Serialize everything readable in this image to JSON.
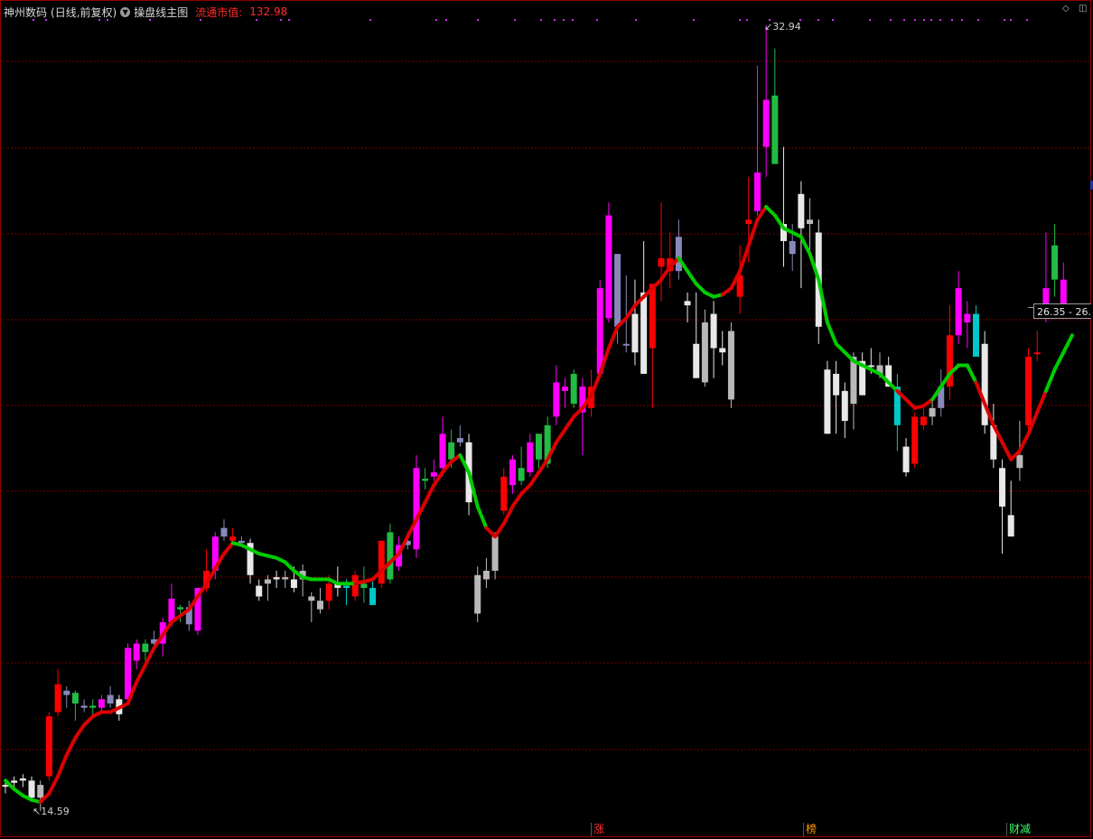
{
  "header": {
    "stock_name": "神州数码",
    "period_info": "(日线,前复权)",
    "indicator_name": "操盘线主图",
    "market_cap_label": "流通市值:",
    "market_cap_value": "132.98"
  },
  "labels": {
    "high_marker": "32.94",
    "low_marker": "14.59",
    "current_price": "26.35 - 26."
  },
  "bottom_tags": {
    "zhang": "涨",
    "bang": "榜",
    "caijian": "财减"
  },
  "colors": {
    "background": "#000000",
    "grid": "#7a0000",
    "up_candle": "#ff0000",
    "hot_candle": "#ff00ff",
    "down_candle": "#e8e8e8",
    "gray_candle": "#b8b8b8",
    "lavender_candle": "#8888bb",
    "green_candle": "#22bb44",
    "cyan_candle": "#00c8c8",
    "line_up": "#dd0000",
    "line_down": "#00cc00",
    "signal_dots": "#cc33ff"
  },
  "chart_data": {
    "type": "candlestick",
    "title": "",
    "price_high": 32.94,
    "price_low": 14.59,
    "current_price": 26.35,
    "candles": [
      {
        "o": 15.2,
        "h": 15.3,
        "l": 15.0,
        "c": 15.2,
        "col": "down"
      },
      {
        "o": 15.25,
        "h": 15.4,
        "l": 15.1,
        "c": 15.3,
        "col": "down"
      },
      {
        "o": 15.3,
        "h": 15.45,
        "l": 15.15,
        "c": 15.35,
        "col": "down"
      },
      {
        "o": 15.3,
        "h": 15.4,
        "l": 14.8,
        "c": 14.9,
        "col": "down"
      },
      {
        "o": 14.9,
        "h": 15.3,
        "l": 14.59,
        "c": 15.2,
        "col": "gray"
      },
      {
        "o": 15.4,
        "h": 16.9,
        "l": 15.3,
        "c": 16.8,
        "col": "up"
      },
      {
        "o": 16.9,
        "h": 17.9,
        "l": 16.8,
        "c": 17.55,
        "col": "up"
      },
      {
        "o": 17.3,
        "h": 17.5,
        "l": 17.0,
        "c": 17.4,
        "col": "lav"
      },
      {
        "o": 17.1,
        "h": 17.4,
        "l": 16.7,
        "c": 17.35,
        "col": "green"
      },
      {
        "o": 17.0,
        "h": 17.2,
        "l": 16.9,
        "c": 17.05,
        "col": "lav"
      },
      {
        "o": 17.0,
        "h": 17.2,
        "l": 16.8,
        "c": 17.05,
        "col": "green"
      },
      {
        "o": 17.0,
        "h": 17.3,
        "l": 16.9,
        "c": 17.2,
        "col": "hot"
      },
      {
        "o": 17.1,
        "h": 17.5,
        "l": 17.0,
        "c": 17.3,
        "col": "lav"
      },
      {
        "o": 17.2,
        "h": 17.3,
        "l": 16.7,
        "c": 16.85,
        "col": "down"
      },
      {
        "o": 17.2,
        "h": 18.5,
        "l": 17.1,
        "c": 18.4,
        "col": "hot"
      },
      {
        "o": 18.1,
        "h": 18.6,
        "l": 17.9,
        "c": 18.5,
        "col": "hot"
      },
      {
        "o": 18.3,
        "h": 18.6,
        "l": 18.1,
        "c": 18.5,
        "col": "green"
      },
      {
        "o": 18.5,
        "h": 18.8,
        "l": 18.3,
        "c": 18.6,
        "col": "lav"
      },
      {
        "o": 18.5,
        "h": 19.1,
        "l": 18.2,
        "c": 19.0,
        "col": "hot"
      },
      {
        "o": 19.0,
        "h": 19.9,
        "l": 18.9,
        "c": 19.55,
        "col": "hot"
      },
      {
        "o": 19.3,
        "h": 19.4,
        "l": 19.0,
        "c": 19.35,
        "col": "green"
      },
      {
        "o": 18.95,
        "h": 19.5,
        "l": 18.8,
        "c": 19.35,
        "col": "lav"
      },
      {
        "o": 18.8,
        "h": 19.5,
        "l": 18.7,
        "c": 19.8,
        "col": "hot"
      },
      {
        "o": 19.8,
        "h": 20.7,
        "l": 19.7,
        "c": 20.2,
        "col": "up"
      },
      {
        "o": 20.2,
        "h": 21.1,
        "l": 20.0,
        "c": 21.0,
        "col": "hot"
      },
      {
        "o": 21.0,
        "h": 21.4,
        "l": 20.9,
        "c": 21.2,
        "col": "lav"
      },
      {
        "o": 21.0,
        "h": 21.2,
        "l": 20.8,
        "c": 20.9,
        "col": "up"
      },
      {
        "o": 20.9,
        "h": 21.0,
        "l": 20.85,
        "c": 20.85,
        "col": "lav"
      },
      {
        "o": 20.85,
        "h": 20.95,
        "l": 19.9,
        "c": 20.1,
        "col": "down"
      },
      {
        "o": 19.85,
        "h": 20.0,
        "l": 19.5,
        "c": 19.6,
        "col": "down"
      },
      {
        "o": 19.9,
        "h": 20.1,
        "l": 19.5,
        "c": 20.0,
        "col": "gray"
      },
      {
        "o": 20.05,
        "h": 20.2,
        "l": 19.8,
        "c": 20.0,
        "col": "down"
      },
      {
        "o": 20.05,
        "h": 20.2,
        "l": 19.8,
        "c": 20.0,
        "col": "gray"
      },
      {
        "o": 20.0,
        "h": 20.3,
        "l": 19.7,
        "c": 19.8,
        "col": "down"
      },
      {
        "o": 20.2,
        "h": 20.35,
        "l": 19.6,
        "c": 20.0,
        "col": "gray"
      },
      {
        "o": 19.5,
        "h": 19.7,
        "l": 19.0,
        "c": 19.6,
        "col": "gray"
      },
      {
        "o": 19.3,
        "h": 19.8,
        "l": 19.2,
        "c": 19.5,
        "col": "gray"
      },
      {
        "o": 19.5,
        "h": 20.1,
        "l": 19.3,
        "c": 19.9,
        "col": "up"
      },
      {
        "o": 19.8,
        "h": 20.3,
        "l": 19.6,
        "c": 19.9,
        "col": "down"
      },
      {
        "o": 19.8,
        "h": 20.0,
        "l": 19.4,
        "c": 19.85,
        "col": "cyan"
      },
      {
        "o": 19.6,
        "h": 20.2,
        "l": 19.5,
        "c": 20.1,
        "col": "up"
      },
      {
        "o": 19.8,
        "h": 20.3,
        "l": 19.45,
        "c": 19.9,
        "col": "green"
      },
      {
        "o": 19.8,
        "h": 20.0,
        "l": 19.4,
        "c": 19.4,
        "col": "cyan"
      },
      {
        "o": 19.9,
        "h": 20.9,
        "l": 19.8,
        "c": 20.9,
        "col": "up"
      },
      {
        "o": 20.0,
        "h": 21.3,
        "l": 19.9,
        "c": 21.1,
        "col": "green"
      },
      {
        "o": 20.3,
        "h": 21.0,
        "l": 20.2,
        "c": 20.8,
        "col": "hot"
      },
      {
        "o": 20.8,
        "h": 21.1,
        "l": 20.7,
        "c": 20.9,
        "col": "lav"
      },
      {
        "o": 20.7,
        "h": 22.9,
        "l": 20.5,
        "c": 22.6,
        "col": "hot"
      },
      {
        "o": 22.3,
        "h": 22.6,
        "l": 22.1,
        "c": 22.35,
        "col": "green"
      },
      {
        "o": 22.4,
        "h": 22.8,
        "l": 22.3,
        "c": 22.5,
        "col": "hot"
      },
      {
        "o": 22.6,
        "h": 23.8,
        "l": 22.4,
        "c": 23.4,
        "col": "hot"
      },
      {
        "o": 22.8,
        "h": 23.5,
        "l": 22.6,
        "c": 23.2,
        "col": "green"
      },
      {
        "o": 23.3,
        "h": 23.6,
        "l": 23.1,
        "c": 23.2,
        "col": "lav"
      },
      {
        "o": 23.2,
        "h": 23.4,
        "l": 21.5,
        "c": 21.8,
        "col": "down"
      },
      {
        "o": 20.1,
        "h": 20.3,
        "l": 19.0,
        "c": 19.2,
        "col": "gray"
      },
      {
        "o": 20.0,
        "h": 20.5,
        "l": 19.8,
        "c": 20.2,
        "col": "gray"
      },
      {
        "o": 20.2,
        "h": 21.1,
        "l": 20.0,
        "c": 21.0,
        "col": "gray"
      },
      {
        "o": 21.6,
        "h": 22.6,
        "l": 21.5,
        "c": 22.4,
        "col": "up"
      },
      {
        "o": 22.2,
        "h": 22.9,
        "l": 22.0,
        "c": 22.8,
        "col": "hot"
      },
      {
        "o": 22.3,
        "h": 23.1,
        "l": 22.2,
        "c": 22.6,
        "col": "green"
      },
      {
        "o": 22.5,
        "h": 23.4,
        "l": 22.4,
        "c": 23.2,
        "col": "hot"
      },
      {
        "o": 22.8,
        "h": 23.4,
        "l": 22.6,
        "c": 23.4,
        "col": "green"
      },
      {
        "o": 22.7,
        "h": 23.8,
        "l": 22.6,
        "c": 23.6,
        "col": "green"
      },
      {
        "o": 23.8,
        "h": 25.0,
        "l": 23.6,
        "c": 24.6,
        "col": "hot"
      },
      {
        "o": 24.4,
        "h": 24.7,
        "l": 24.0,
        "c": 24.5,
        "col": "hot"
      },
      {
        "o": 24.1,
        "h": 24.9,
        "l": 24.0,
        "c": 24.8,
        "col": "green"
      },
      {
        "o": 24.5,
        "h": 24.7,
        "l": 22.9,
        "c": 23.9,
        "col": "hot"
      },
      {
        "o": 24.0,
        "h": 24.9,
        "l": 23.8,
        "c": 24.5,
        "col": "up"
      },
      {
        "o": 24.8,
        "h": 27.0,
        "l": 24.7,
        "c": 26.8,
        "col": "hot"
      },
      {
        "o": 26.1,
        "h": 28.8,
        "l": 26.0,
        "c": 28.5,
        "col": "hot"
      },
      {
        "o": 25.9,
        "h": 26.6,
        "l": 25.5,
        "c": 27.6,
        "col": "lav"
      },
      {
        "o": 25.5,
        "h": 27.1,
        "l": 25.3,
        "c": 25.5,
        "col": "lav"
      },
      {
        "o": 26.2,
        "h": 27.0,
        "l": 25.0,
        "c": 25.3,
        "col": "down"
      },
      {
        "o": 26.7,
        "h": 27.9,
        "l": 25.3,
        "c": 24.8,
        "col": "down"
      },
      {
        "o": 25.4,
        "h": 26.9,
        "l": 24.0,
        "c": 26.9,
        "col": "up"
      },
      {
        "o": 27.5,
        "h": 28.8,
        "l": 26.5,
        "c": 27.3,
        "col": "up"
      },
      {
        "o": 27.2,
        "h": 28.1,
        "l": 26.8,
        "c": 27.5,
        "col": "up"
      },
      {
        "o": 27.2,
        "h": 28.4,
        "l": 27.0,
        "c": 28.0,
        "col": "lav"
      },
      {
        "o": 26.5,
        "h": 26.7,
        "l": 26.0,
        "c": 26.4,
        "col": "down"
      },
      {
        "o": 25.5,
        "h": 26.7,
        "l": 24.7,
        "c": 24.7,
        "col": "down"
      },
      {
        "o": 26.0,
        "h": 26.3,
        "l": 24.5,
        "c": 24.6,
        "col": "gray"
      },
      {
        "o": 26.2,
        "h": 26.5,
        "l": 24.7,
        "c": 25.4,
        "col": "down"
      },
      {
        "o": 25.4,
        "h": 25.8,
        "l": 25.0,
        "c": 25.3,
        "col": "down"
      },
      {
        "o": 25.8,
        "h": 26.0,
        "l": 24.0,
        "c": 24.2,
        "col": "gray"
      },
      {
        "o": 26.6,
        "h": 27.8,
        "l": 26.2,
        "c": 27.1,
        "col": "up"
      },
      {
        "o": 28.3,
        "h": 29.4,
        "l": 27.4,
        "c": 28.4,
        "col": "up"
      },
      {
        "o": 28.6,
        "h": 32.0,
        "l": 28.5,
        "c": 29.5,
        "col": "hot"
      },
      {
        "o": 30.1,
        "h": 32.94,
        "l": 29.4,
        "c": 31.2,
        "col": "hot"
      },
      {
        "o": 31.3,
        "h": 32.4,
        "l": 30.0,
        "c": 29.7,
        "col": "green"
      },
      {
        "o": 27.9,
        "h": 30.1,
        "l": 27.3,
        "c": 28.3,
        "col": "down"
      },
      {
        "o": 27.9,
        "h": 28.3,
        "l": 27.2,
        "c": 27.6,
        "col": "lav"
      },
      {
        "o": 29.0,
        "h": 29.3,
        "l": 26.8,
        "c": 28.2,
        "col": "down"
      },
      {
        "o": 28.4,
        "h": 28.9,
        "l": 27.6,
        "c": 28.3,
        "col": "gray"
      },
      {
        "o": 28.1,
        "h": 28.4,
        "l": 25.5,
        "c": 25.9,
        "col": "down"
      },
      {
        "o": 24.9,
        "h": 25.1,
        "l": 23.6,
        "c": 23.4,
        "col": "down"
      },
      {
        "o": 24.8,
        "h": 25.1,
        "l": 23.4,
        "c": 24.3,
        "col": "down"
      },
      {
        "o": 24.4,
        "h": 24.6,
        "l": 23.3,
        "c": 23.7,
        "col": "down"
      },
      {
        "o": 24.1,
        "h": 25.3,
        "l": 23.5,
        "c": 25.2,
        "col": "gray"
      },
      {
        "o": 25.1,
        "h": 25.3,
        "l": 24.5,
        "c": 24.3,
        "col": "down"
      },
      {
        "o": 25.0,
        "h": 25.4,
        "l": 24.8,
        "c": 25.0,
        "col": "down"
      },
      {
        "o": 25.0,
        "h": 25.3,
        "l": 24.7,
        "c": 24.8,
        "col": "gray"
      },
      {
        "o": 25.0,
        "h": 25.2,
        "l": 24.5,
        "c": 24.5,
        "col": "down"
      },
      {
        "o": 24.5,
        "h": 24.8,
        "l": 23.0,
        "c": 23.6,
        "col": "cyan"
      },
      {
        "o": 23.1,
        "h": 23.3,
        "l": 22.4,
        "c": 22.5,
        "col": "down"
      },
      {
        "o": 22.7,
        "h": 23.9,
        "l": 22.6,
        "c": 23.8,
        "col": "up"
      },
      {
        "o": 23.6,
        "h": 24.1,
        "l": 23.5,
        "c": 23.8,
        "col": "up"
      },
      {
        "o": 23.8,
        "h": 24.2,
        "l": 23.6,
        "c": 24.0,
        "col": "gray"
      },
      {
        "o": 24.0,
        "h": 24.9,
        "l": 23.8,
        "c": 24.5,
        "col": "lav"
      },
      {
        "o": 24.5,
        "h": 26.4,
        "l": 24.2,
        "c": 25.7,
        "col": "up"
      },
      {
        "o": 25.7,
        "h": 27.2,
        "l": 25.5,
        "c": 26.8,
        "col": "hot"
      },
      {
        "o": 26.0,
        "h": 26.5,
        "l": 25.4,
        "c": 26.2,
        "col": "hot"
      },
      {
        "o": 26.2,
        "h": 26.4,
        "l": 25.2,
        "c": 25.2,
        "col": "cyan"
      },
      {
        "o": 25.5,
        "h": 25.8,
        "l": 23.4,
        "c": 23.6,
        "col": "down"
      },
      {
        "o": 23.6,
        "h": 24.1,
        "l": 22.6,
        "c": 22.8,
        "col": "down"
      },
      {
        "o": 22.6,
        "h": 22.8,
        "l": 20.6,
        "c": 21.7,
        "col": "down"
      },
      {
        "o": 21.5,
        "h": 22.3,
        "l": 21.0,
        "c": 21.0,
        "col": "down"
      },
      {
        "o": 22.9,
        "h": 23.7,
        "l": 22.3,
        "c": 22.6,
        "col": "gray"
      },
      {
        "o": 23.6,
        "h": 25.4,
        "l": 23.4,
        "c": 25.2,
        "col": "up"
      },
      {
        "o": 25.3,
        "h": 25.8,
        "l": 25.1,
        "c": 25.3,
        "col": "up"
      },
      {
        "o": 26.2,
        "h": 28.1,
        "l": 26.0,
        "c": 26.8,
        "col": "hot"
      },
      {
        "o": 27.0,
        "h": 28.3,
        "l": 26.6,
        "c": 27.8,
        "col": "green"
      },
      {
        "o": 26.3,
        "h": 27.4,
        "l": 26.1,
        "c": 27.0,
        "col": "hot"
      }
    ],
    "operating_line": [
      15.3,
      15.1,
      14.95,
      14.85,
      14.8,
      15.0,
      15.4,
      15.9,
      16.3,
      16.6,
      16.8,
      16.9,
      16.9,
      17.0,
      17.1,
      17.6,
      18.0,
      18.4,
      18.7,
      19.0,
      19.15,
      19.3,
      19.6,
      19.9,
      20.25,
      20.6,
      20.85,
      20.8,
      20.7,
      20.6,
      20.55,
      20.5,
      20.4,
      20.2,
      20.05,
      20.0,
      20.0,
      20.0,
      19.9,
      19.9,
      19.9,
      19.95,
      20.0,
      20.2,
      20.4,
      20.6,
      21.0,
      21.4,
      21.8,
      22.2,
      22.5,
      22.75,
      22.9,
      22.5,
      21.7,
      21.2,
      21.0,
      21.3,
      21.7,
      22.0,
      22.2,
      22.5,
      22.8,
      23.2,
      23.5,
      23.8,
      24.0,
      24.3,
      24.8,
      25.4,
      25.9,
      26.1,
      26.4,
      26.6,
      26.8,
      27.0,
      27.3,
      27.5,
      27.2,
      26.9,
      26.7,
      26.6,
      26.65,
      26.8,
      27.2,
      27.8,
      28.4,
      28.7,
      28.5,
      28.2,
      28.1,
      28.0,
      27.6,
      27.0,
      26.0,
      25.5,
      25.3,
      25.1,
      25.0,
      24.9,
      24.8,
      24.6,
      24.4,
      24.2,
      24.0,
      24.05,
      24.2,
      24.5,
      24.8,
      25.0,
      25.0,
      24.6,
      24.1,
      23.6,
      23.2,
      22.8,
      23.0,
      23.4,
      23.9,
      24.4,
      24.9,
      25.3,
      25.7
    ],
    "line_trend": [
      "down",
      "down",
      "down",
      "down",
      "down",
      "up",
      "up",
      "up",
      "up",
      "up",
      "up",
      "up",
      "up",
      "up",
      "up",
      "up",
      "up",
      "up",
      "up",
      "up",
      "up",
      "up",
      "up",
      "up",
      "up",
      "up",
      "up",
      "down",
      "down",
      "down",
      "down",
      "down",
      "down",
      "down",
      "down",
      "down",
      "down",
      "down",
      "down",
      "down",
      "down",
      "up",
      "up",
      "up",
      "up",
      "up",
      "up",
      "up",
      "up",
      "up",
      "up",
      "up",
      "up",
      "down",
      "down",
      "down",
      "up",
      "up",
      "up",
      "up",
      "up",
      "up",
      "up",
      "up",
      "up",
      "up",
      "up",
      "up",
      "up",
      "up",
      "up",
      "up",
      "up",
      "up",
      "up",
      "up",
      "up",
      "up",
      "down",
      "down",
      "down",
      "down",
      "down",
      "up",
      "up",
      "up",
      "up",
      "up",
      "down",
      "down",
      "down",
      "down",
      "down",
      "down",
      "down",
      "down",
      "down",
      "down",
      "down",
      "down",
      "down",
      "down",
      "down",
      "up",
      "up",
      "up",
      "up",
      "down",
      "down",
      "down",
      "down",
      "down",
      "up",
      "up",
      "up",
      "up",
      "up",
      "up",
      "up"
    ]
  }
}
